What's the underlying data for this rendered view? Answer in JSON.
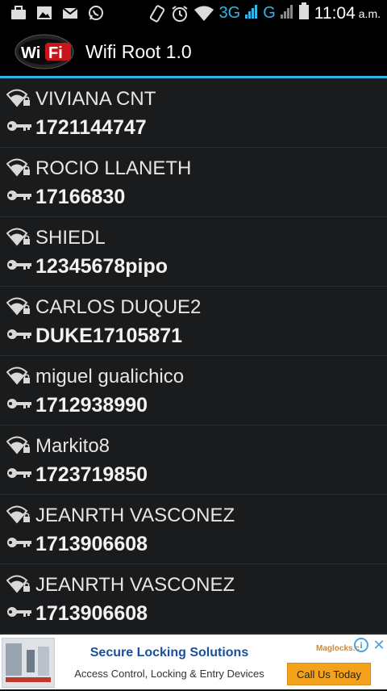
{
  "statusbar": {
    "left_icons": [
      "briefcase-icon",
      "image-icon",
      "mail-icon",
      "whatsapp-icon"
    ],
    "right_icons": [
      "screen-rotate-icon",
      "alarm-icon",
      "wifi-icon"
    ],
    "net_3g": "3G",
    "net_g": "G",
    "time": "11:04",
    "ampm": "a.m."
  },
  "actionbar": {
    "logo_text_wi": "Wi",
    "logo_text_fi": "Fi",
    "title": "Wifi Root 1.0"
  },
  "networks": [
    {
      "ssid": "VIVIANA CNT",
      "password": "1721144747"
    },
    {
      "ssid": "ROCIO LLANETH",
      "password": "17166830"
    },
    {
      "ssid": "SHIEDL",
      "password": "12345678pipo"
    },
    {
      "ssid": "CARLOS DUQUE2",
      "password": "DUKE17105871"
    },
    {
      "ssid": "miguel gualichico",
      "password": "1712938990"
    },
    {
      "ssid": "Markito8",
      "password": "1723719850"
    },
    {
      "ssid": "JEANRTH VASCONEZ",
      "password": "1713906608"
    },
    {
      "ssid": "JEANRTH VASCONEZ",
      "password": "1713906608"
    }
  ],
  "ad": {
    "headline": "Secure Locking Solutions",
    "body": "Access Control, Locking & Entry Devices",
    "brand": "Maglocks.c",
    "cta": "Call Us Today",
    "info_glyph": "i",
    "close_glyph": "✕"
  },
  "colors": {
    "accent": "#33b5e5",
    "background": "#131416",
    "row": "#1a1b1d",
    "logo_red": "#c8141b",
    "cta": "#f4a21c"
  }
}
